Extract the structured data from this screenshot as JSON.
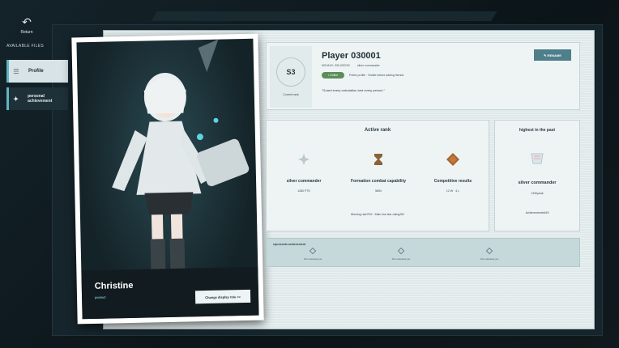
{
  "nav": {
    "return_label": "Return",
    "files_label": "AVAILABLE FILES",
    "items": [
      {
        "label": "Profile",
        "icon": "list-icon"
      },
      {
        "label": "personal achievement",
        "icon": "star-icon"
      }
    ]
  },
  "character": {
    "name": "Christine",
    "subtitle": "protect",
    "change_button": "Change display role >>"
  },
  "profile": {
    "rank_badge": "S3",
    "rank_caption": "Current rank",
    "player_name": "Player 030001",
    "player_id": "NOVA ID: 030-000749",
    "title": "silver commander",
    "online": "• Online",
    "visibility": "Public profile · Visible before adding friends",
    "motto": "\"Guard every calculation and every person.\"",
    "rename_button": "✎ RENAME"
  },
  "active_rank": {
    "title": "Active rank",
    "stats": [
      {
        "label": "silver commander",
        "value": "1280 PTS",
        "icon": "diamond-star-icon"
      },
      {
        "label": "Formation combat capability",
        "value": "5894",
        "icon": "hourglass-icon"
      },
      {
        "label": "Competitive results",
        "value": "12 W · 4 L",
        "icon": "diamond-icon"
      }
    ],
    "winrate": "Winning rate75% · Main line star rating262"
  },
  "highest": {
    "title": "highest in the past",
    "rank": "silver commander",
    "points": "1330peak",
    "achievements": "Achievements6/45"
  },
  "achievements": {
    "title": "represents achievement",
    "slots": [
      "Not unlocked yet",
      "Not unlocked yet",
      "Not unlocked yet"
    ]
  },
  "colors": {
    "accent": "#5fb6c3",
    "online": "#5d8d5a",
    "rename": "#4e7f8b",
    "panel": "#eef4f4"
  }
}
